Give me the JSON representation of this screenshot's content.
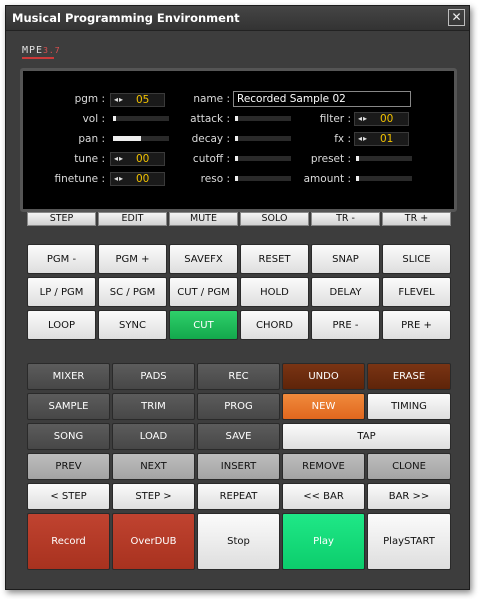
{
  "window": {
    "title": "Musical Programming Environment",
    "close_glyph": "✕"
  },
  "logo": {
    "text": "MPE",
    "version": "3.7"
  },
  "display": {
    "pgm": {
      "label": "pgm :",
      "arrows": "◂▸",
      "value": "05"
    },
    "vol": {
      "label": "vol :",
      "level": 0.05
    },
    "pan": {
      "label": "pan :",
      "level": 0.5
    },
    "tune": {
      "label": "tune :",
      "arrows": "◂▸",
      "value": "00"
    },
    "finetune": {
      "label": "finetune :",
      "arrows": "◂▸",
      "value": "00"
    },
    "name": {
      "label": "name :",
      "value": "Recorded Sample 02"
    },
    "attack": {
      "label": "attack :",
      "level": 0.05
    },
    "decay": {
      "label": "decay :",
      "level": 0.05
    },
    "cutoff": {
      "label": "cutoff :",
      "level": 0.05
    },
    "reso": {
      "label": "reso :",
      "level": 0.05
    },
    "filter": {
      "label": "filter :",
      "arrows": "◂▸",
      "value": "00"
    },
    "fx": {
      "label": "fx :",
      "arrows": "◂▸",
      "value": "01"
    },
    "preset": {
      "label": "preset :",
      "level": 0.05
    },
    "amount": {
      "label": "amount :",
      "level": 0.05
    }
  },
  "tabs": [
    "STEP",
    "EDIT",
    "MUTE",
    "SOLO",
    "TR -",
    "TR +"
  ],
  "grid_top": [
    [
      "PGM -",
      "PGM +",
      "SAVEFX",
      "RESET",
      "SNAP",
      "SLICE"
    ],
    [
      "LP / PGM",
      "SC / PGM",
      "CUT / PGM",
      "HOLD",
      "DELAY",
      "FLEVEL"
    ],
    [
      "LOOP",
      "SYNC",
      "CUT",
      "CHORD",
      "PRE -",
      "PRE +"
    ]
  ],
  "transport": {
    "mixer": "MIXER",
    "pads": "PADS",
    "rec": "REC",
    "undo": "UNDO",
    "erase": "ERASE",
    "sample": "SAMPLE",
    "trim": "TRIM",
    "prog": "PROG",
    "new": "NEW",
    "timing": "TIMING",
    "song": "SONG",
    "load": "LOAD",
    "save": "SAVE",
    "tap": "TAP",
    "prev": "PREV",
    "next": "NEXT",
    "insert": "INSERT",
    "remove": "REMOVE",
    "clone": "CLONE",
    "step_back": "< STEP",
    "step_fwd": "STEP >",
    "repeat": "REPEAT",
    "bar_back": "<< BAR",
    "bar_fwd": "BAR >>",
    "record": "Record",
    "overdub": "OverDUB",
    "stop": "Stop",
    "play": "Play",
    "playstart": "PlaySTART"
  },
  "colors": {
    "accent_green": "#13a84c",
    "value_yellow": "#f2c200",
    "undo_brown": "#6b2c0e",
    "new_orange": "#e8772b",
    "record_red": "#b23a27",
    "play_green": "#14db79"
  }
}
